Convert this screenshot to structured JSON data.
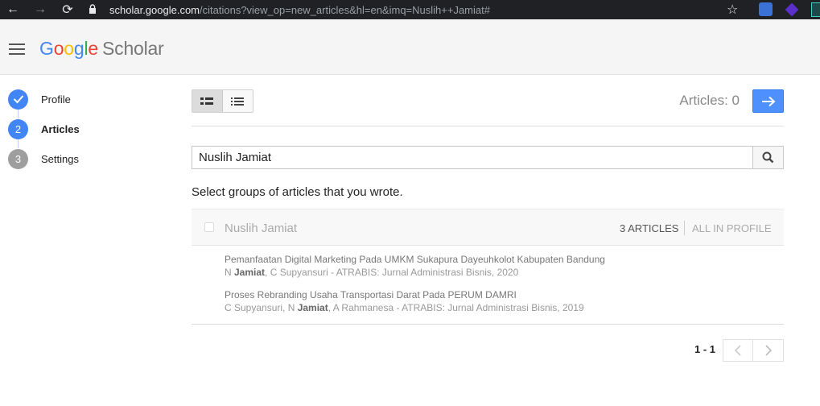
{
  "browser": {
    "url_host": "scholar.google.com",
    "url_path": "/citations?view_op=new_articles&hl=en&imq=Nuslih++Jamiat#"
  },
  "header": {
    "logo_letters": [
      "G",
      "o",
      "o",
      "g",
      "l",
      "e"
    ],
    "logo_product": "Scholar"
  },
  "steps": [
    {
      "number": "",
      "label": "Profile",
      "state": "done"
    },
    {
      "number": "2",
      "label": "Articles",
      "state": "active"
    },
    {
      "number": "3",
      "label": "Settings",
      "state": "pending"
    }
  ],
  "toolbar": {
    "articles_count": "Articles: 0"
  },
  "search": {
    "value": "Nuslih  Jamiat"
  },
  "instruction": "Select groups of articles that you wrote.",
  "group": {
    "name": "Nuslih Jamiat",
    "count_label": "3 ARTICLES",
    "all_in_profile_label": "ALL IN PROFILE"
  },
  "articles": [
    {
      "title": "Pemanfaatan Digital Marketing Pada UMKM Sukapura Dayeuhkolot Kabupaten Bandung",
      "author_pre": "N ",
      "author_bold": "Jamiat",
      "author_post": ", C Supyansuri - ATRABIS: Jurnal Administrasi Bisnis, 2020"
    },
    {
      "title": "Proses Rebranding Usaha Transportasi Darat Pada PERUM DAMRI",
      "author_pre": "C Supyansuri, N ",
      "author_bold": "Jamiat",
      "author_post": ", A Rahmanesa - ATRABIS: Jurnal Administrasi Bisnis, 2019"
    }
  ],
  "pagination": {
    "range": "1 - 1"
  },
  "colors": {
    "accent_blue": "#4285f4",
    "button_blue": "#4d90fe",
    "step_inactive": "#9e9e9e"
  }
}
